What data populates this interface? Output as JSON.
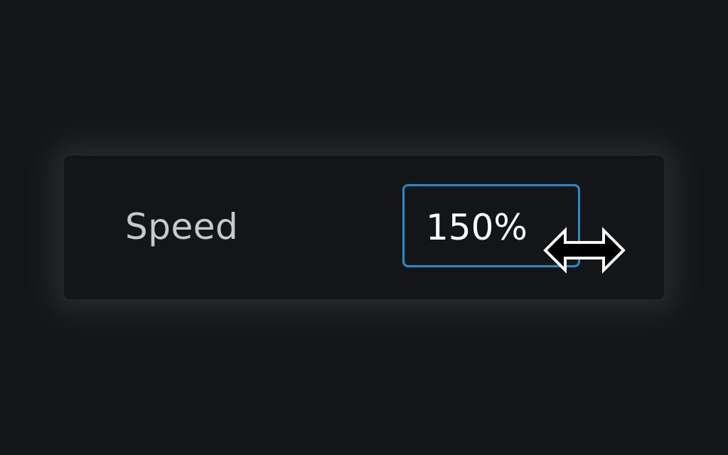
{
  "control": {
    "label": "Speed",
    "value": "150%"
  },
  "cursor": {
    "icon": "horizontal-resize-cursor-icon"
  },
  "colors": {
    "background": "#151618",
    "panel": "#141517",
    "accent_border": "#1a8fd6",
    "label_text": "#c9c9cc",
    "value_text": "#ffffff"
  }
}
